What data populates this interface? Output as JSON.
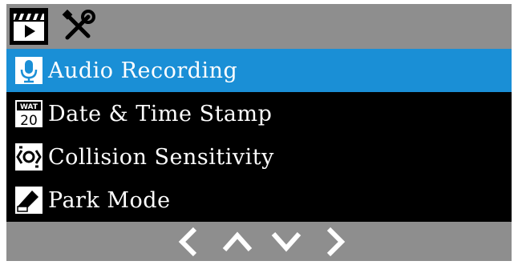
{
  "tabs": [
    {
      "icon": "video-clapper-icon",
      "selected": true
    },
    {
      "icon": "tools-icon",
      "selected": false
    }
  ],
  "menu": {
    "items": [
      {
        "label": "Audio Recording",
        "icon": "microphone-icon",
        "selected": true
      },
      {
        "label": "Date & Time Stamp",
        "icon": "calendar-icon",
        "icon_text_top": "WAT",
        "icon_text_bottom": "20",
        "selected": false
      },
      {
        "label": "Collision Sensitivity",
        "icon": "collision-sensor-icon",
        "selected": false
      },
      {
        "label": "Park Mode",
        "icon": "park-mode-icon",
        "selected": false
      }
    ]
  },
  "navigation": [
    "left-arrow-icon",
    "up-arrow-icon",
    "down-arrow-icon",
    "right-arrow-icon"
  ],
  "colors": {
    "highlight": "#1a8fd6",
    "bar": "#8e8e8e",
    "background": "#000000",
    "text": "#ffffff"
  }
}
